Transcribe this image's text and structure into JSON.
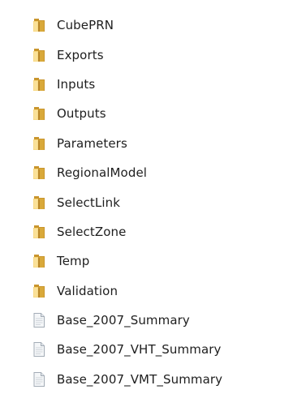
{
  "explorer": {
    "items": [
      {
        "label": "CubePRN",
        "icon": "folder-icon",
        "kind": "folder"
      },
      {
        "label": "Exports",
        "icon": "folder-icon",
        "kind": "folder"
      },
      {
        "label": "Inputs",
        "icon": "folder-icon",
        "kind": "folder"
      },
      {
        "label": "Outputs",
        "icon": "folder-icon",
        "kind": "folder"
      },
      {
        "label": "Parameters",
        "icon": "folder-icon",
        "kind": "folder"
      },
      {
        "label": "RegionalModel",
        "icon": "folder-icon",
        "kind": "folder"
      },
      {
        "label": "SelectLink",
        "icon": "folder-icon",
        "kind": "folder"
      },
      {
        "label": "SelectZone",
        "icon": "folder-icon",
        "kind": "folder"
      },
      {
        "label": "Temp",
        "icon": "folder-icon",
        "kind": "folder"
      },
      {
        "label": "Validation",
        "icon": "folder-icon",
        "kind": "folder"
      },
      {
        "label": "Base_2007_Summary",
        "icon": "document-icon",
        "kind": "file"
      },
      {
        "label": "Base_2007_VHT_Summary",
        "icon": "document-icon",
        "kind": "file"
      },
      {
        "label": "Base_2007_VMT_Summary",
        "icon": "document-icon",
        "kind": "file"
      }
    ]
  },
  "colors": {
    "folder_light": "#f7d57a",
    "folder_dark": "#d9a93a",
    "folder_back": "#c9952c",
    "document_fill": "#f4f6f8",
    "document_stroke": "#a3acb6",
    "text": "#1e1e1e"
  }
}
